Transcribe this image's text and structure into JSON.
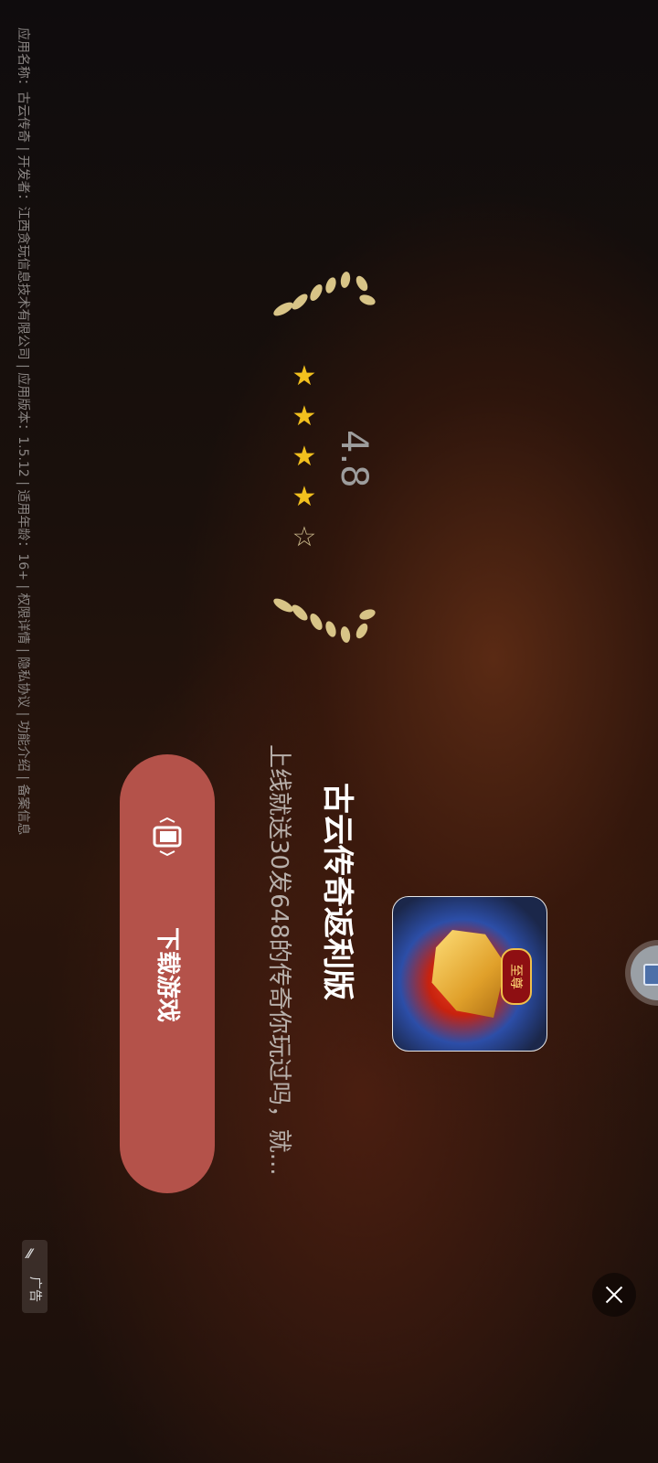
{
  "ad": {
    "app_name": "古云传奇返利版",
    "description": "上线就送30发648的传奇你玩过吗，就...",
    "download_label": "下载游戏",
    "rating_value": "4.8",
    "rating_stars": 4.5,
    "icon_badge": "至尊",
    "ad_label": "广告",
    "info_strip": "应用名称：古云传奇 | 开发者：江西贪玩信息技术有限公司 | 应用版本：1.5.12 | 适用年龄：16+ | 权限详情 | 隐私协议 | 功能介绍 | 备案信息"
  },
  "icons": {
    "close": "close-icon",
    "shake": "shake-phone-icon",
    "float": "cube-icon",
    "laurel": "laurel-icon",
    "star": "star-icon"
  },
  "colors": {
    "download_button": "#b4524a",
    "star": "#f2c01e",
    "title": "#ffffff"
  }
}
